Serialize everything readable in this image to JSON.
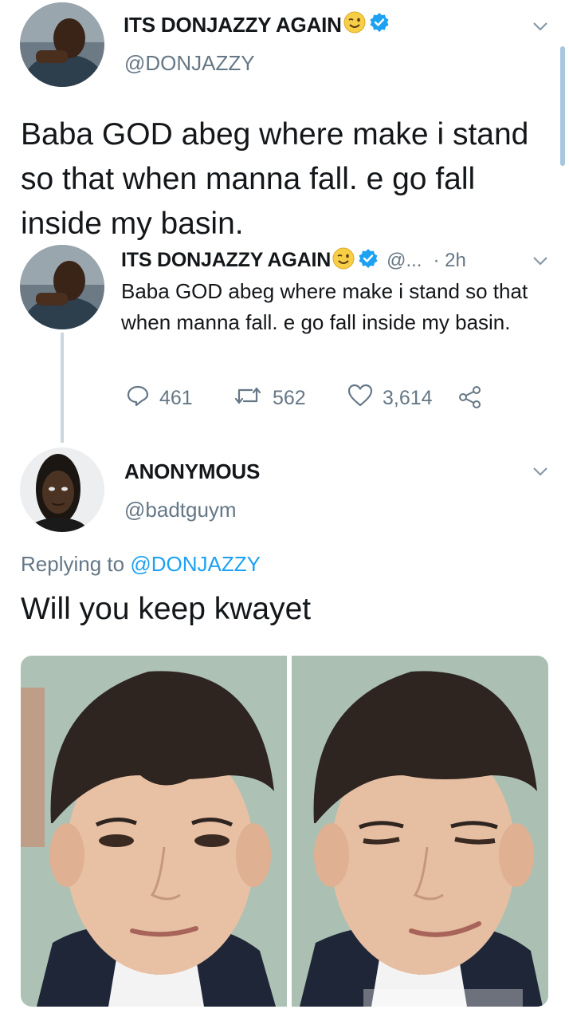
{
  "colors": {
    "text": "#14171a",
    "secondary": "#657786",
    "accent": "#1da1f2",
    "thread_line": "#ccd6dd",
    "scrollbar": "#a9c6df"
  },
  "main_tweet": {
    "author_name": "ITS DONJAZZY AGAIN",
    "author_handle": "@DONJAZZY",
    "text": "Baba GOD abeg where make i stand so that when manna fall. e go fall inside my basin."
  },
  "quoted_tweet": {
    "author_name": "ITS DONJAZZY AGAIN",
    "handle_truncated": "@...",
    "time": "· 2h",
    "text": "Baba GOD abeg where make i stand so that when manna fall. e go fall inside my basin.",
    "replies": "461",
    "retweets": "562",
    "likes": "3,614"
  },
  "reply_tweet": {
    "author_name": "ANONYMOUS",
    "author_handle": "@badtguym",
    "replying_prefix": "Replying to",
    "replying_handle": "@DONJAZZY",
    "text": "Will you keep kwayet"
  },
  "icons": [
    "winking-face-emoji",
    "verified-badge-icon",
    "chevron-down-icon",
    "reply-icon",
    "retweet-icon",
    "like-icon",
    "share-icon"
  ]
}
